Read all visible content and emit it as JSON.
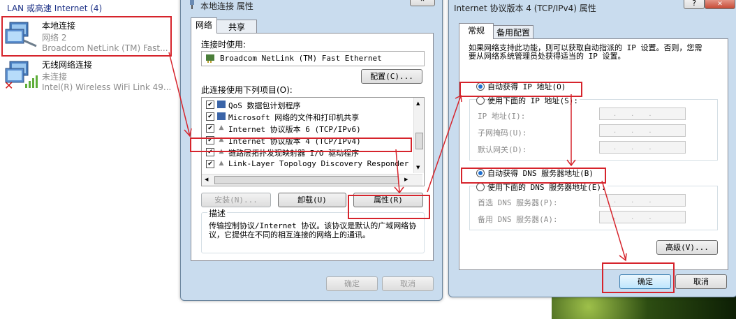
{
  "left_pane": {
    "group_header": "LAN 或高速 Internet (4)",
    "items": [
      {
        "name": "本地连接",
        "status": "网络 2",
        "adapter": "Broadcom NetLink (TM) Fast..."
      },
      {
        "name": "无线网络连接",
        "status": "未连接",
        "adapter": "Intel(R) Wireless WiFi Link 49..."
      }
    ]
  },
  "props_dialog": {
    "title": "本地连接 属性",
    "tabs": [
      "网络",
      "共享"
    ],
    "connect_using_label": "连接时使用:",
    "adapter_name": "Broadcom NetLink (TM) Fast Ethernet",
    "configure_button": "配置(C)...",
    "items_label": "此连接使用下列项目(O):",
    "items": [
      {
        "label": "QoS 数据包计划程序",
        "checked": true
      },
      {
        "label": "Microsoft 网络的文件和打印机共享",
        "checked": true
      },
      {
        "label": "Internet 协议版本 6 (TCP/IPv6)",
        "checked": true
      },
      {
        "label": "Internet 协议版本 4 (TCP/IPv4)",
        "checked": true
      },
      {
        "label": "链路层拓扑发现映射器 I/O 驱动程序",
        "checked": true
      },
      {
        "label": "Link-Layer Topology Discovery Responder",
        "checked": true
      }
    ],
    "install_button": "安装(N)...",
    "uninstall_button": "卸载(U)",
    "properties_button": "属性(R)",
    "description_label": "描述",
    "description_text": "传输控制协议/Internet 协议。该协议是默认的广域网络协议，它提供在不同的相互连接的网络上的通讯。",
    "ok_button": "确定",
    "cancel_button": "取消"
  },
  "ipv4_dialog": {
    "title": "Internet 协议版本 4 (TCP/IPv4) 属性",
    "help_button": "?",
    "close_button": "✕",
    "tabs": [
      "常规",
      "备用配置"
    ],
    "intro_text": "如果网络支持此功能，则可以获取自动指派的 IP 设置。否则，您需要从网络系统管理员处获得适当的 IP 设置。",
    "auto_ip_radio": "自动获得 IP 地址(O)",
    "manual_ip_radio": "使用下面的 IP 地址(S):",
    "ip_address_label": "IP 地址(I):",
    "subnet_label": "子网掩码(U):",
    "gateway_label": "默认网关(D):",
    "auto_dns_radio": "自动获得 DNS 服务器地址(B)",
    "manual_dns_radio": "使用下面的 DNS 服务器地址(E):",
    "preferred_dns_label": "首选 DNS 服务器(P):",
    "alternate_dns_label": "备用 DNS 服务器(A):",
    "ip_placeholder": "...",
    "advanced_button": "高级(V)...",
    "ok_button": "确定",
    "cancel_button": "取消"
  },
  "colors": {
    "annotation_red": "#d6242c",
    "accent_blue": "#1d6fcf"
  }
}
